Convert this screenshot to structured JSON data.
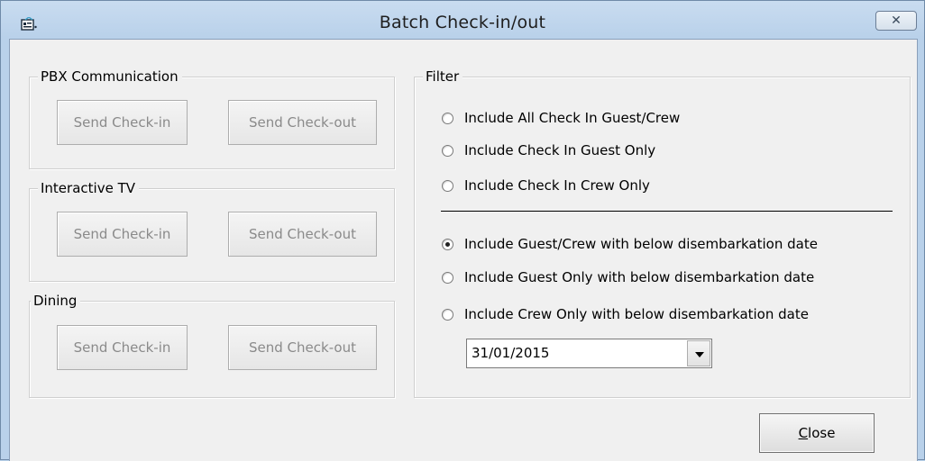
{
  "window": {
    "title": "Batch Check-in/out",
    "close_glyph": "✕",
    "icon": "app-window-icon"
  },
  "groups": {
    "pbx": {
      "legend": "PBX Communication",
      "checkin_label": "Send Check-in",
      "checkout_label": "Send Check-out"
    },
    "itv": {
      "legend": "Interactive TV",
      "checkin_label": "Send Check-in",
      "checkout_label": "Send Check-out"
    },
    "dining": {
      "legend": "Dining",
      "checkin_label": "Send Check-in",
      "checkout_label": "Send Check-out"
    }
  },
  "filter": {
    "legend": "Filter",
    "options": [
      {
        "label": "Include All Check In Guest/Crew",
        "checked": false
      },
      {
        "label": "Include Check In Guest Only",
        "checked": false
      },
      {
        "label": "Include Check In Crew Only",
        "checked": false
      },
      {
        "label": "Include Guest/Crew with below disembarkation date",
        "checked": true
      },
      {
        "label": "Include Guest Only with below disembarkation date",
        "checked": false
      },
      {
        "label": "Include Crew Only with below disembarkation date",
        "checked": false
      }
    ],
    "date_value": "31/01/2015"
  },
  "footer": {
    "close_mnemonic": "C",
    "close_rest": "lose"
  }
}
